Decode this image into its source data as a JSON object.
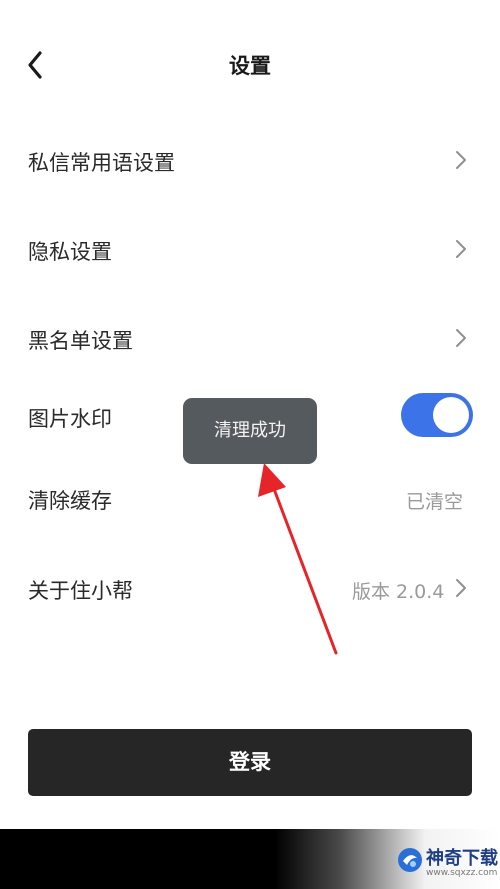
{
  "header": {
    "title": "设置"
  },
  "settings": {
    "items": [
      {
        "label": "私信常用语设置"
      },
      {
        "label": "隐私设置"
      },
      {
        "label": "黑名单设置"
      },
      {
        "label": "图片水印",
        "toggle_on": true
      },
      {
        "label": "清除缓存",
        "value": "已清空"
      },
      {
        "label": "关于住小帮",
        "value": "版本 2.0.4"
      }
    ]
  },
  "toast": {
    "text": "清理成功"
  },
  "login_button": {
    "label": "登录"
  },
  "watermark": {
    "name": "神奇下载",
    "url": "www.sqxzz.com"
  },
  "colors": {
    "toggle_on": "#3c73e8",
    "arrow": "#e5252a",
    "button_bg": "#262626",
    "toast_bg": "#555a5f"
  }
}
